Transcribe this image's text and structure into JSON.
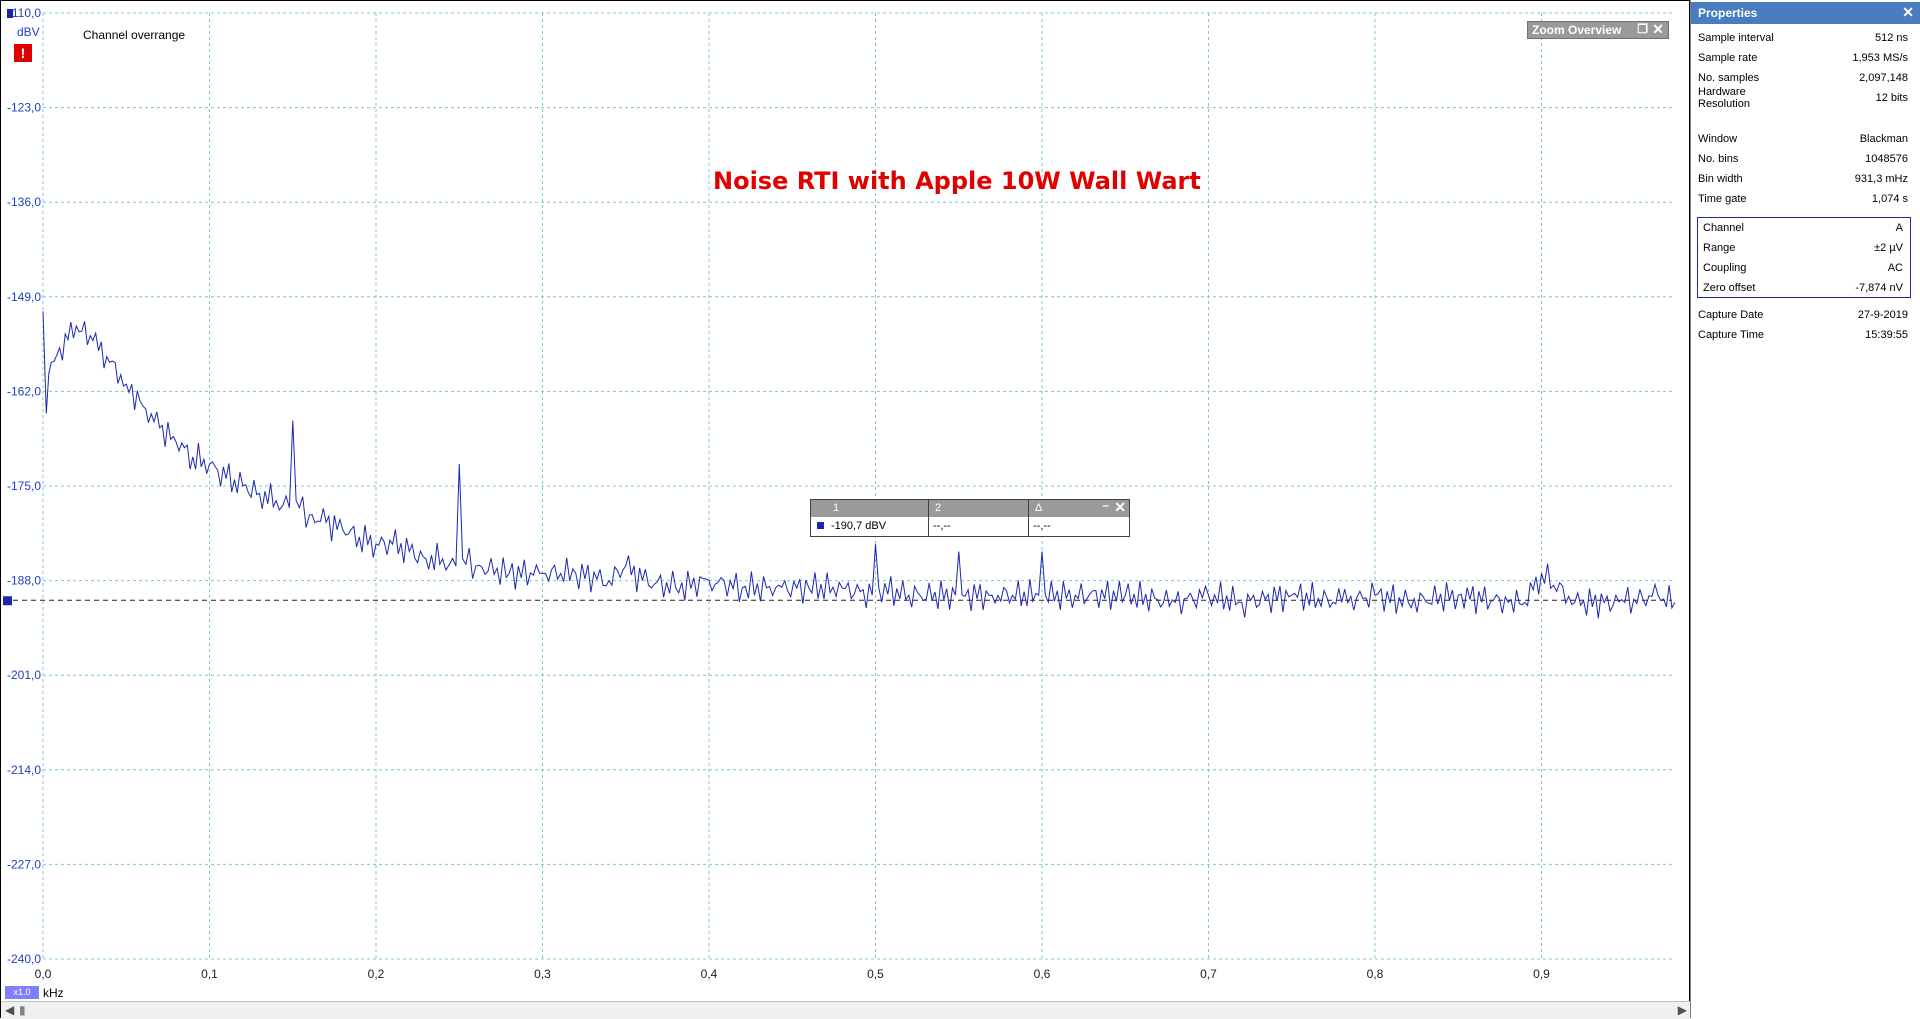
{
  "overrange_label": "Channel overrange",
  "unit_y": "dBV",
  "unit_x": "kHz",
  "zoom_badge": "x1.0",
  "zoom_overview": {
    "title": "Zoom Overview"
  },
  "ruler": {
    "headers": [
      "1",
      "2",
      "Δ"
    ],
    "values": [
      "-190,7 dBV",
      "--,--",
      "--,--"
    ]
  },
  "properties": {
    "title": "Properties",
    "rows": [
      {
        "k": "Sample interval",
        "v": "512 ns"
      },
      {
        "k": "Sample rate",
        "v": "1,953 MS/s"
      },
      {
        "k": "No. samples",
        "v": "2,097,148"
      },
      {
        "k": "Hardware Resolution",
        "v": "12 bits"
      },
      {
        "k": "Window",
        "v": "Blackman"
      },
      {
        "k": "No. bins",
        "v": "1048576"
      },
      {
        "k": "Bin width",
        "v": "931,3 mHz"
      },
      {
        "k": "Time gate",
        "v": "1,074 s"
      },
      {
        "k": "Channel",
        "v": "A"
      },
      {
        "k": "Range",
        "v": "±2 µV"
      },
      {
        "k": "Coupling",
        "v": "AC"
      },
      {
        "k": "Zero offset",
        "v": "-7,874 nV"
      },
      {
        "k": "Capture Date",
        "v": "27-9-2019"
      },
      {
        "k": "Capture Time",
        "v": "15:39:55"
      }
    ]
  },
  "chart_data": {
    "type": "line",
    "title": "Noise RTI with Apple 10W Wall Wart",
    "ylabel": "dBV",
    "xlabel": "kHz",
    "ylim": [
      -240,
      -110
    ],
    "xlim": [
      0,
      0.98
    ],
    "y_ticks": [
      "-110,0",
      "-123,0",
      "-136,0",
      "-149,0",
      "-162,0",
      "-175,0",
      "-188,0",
      "-201,0",
      "-214,0",
      "-227,0",
      "-240,0"
    ],
    "y_tick_values": [
      -110,
      -123,
      -136,
      -149,
      -162,
      -175,
      -188,
      -201,
      -214,
      -227,
      -240
    ],
    "x_ticks": [
      "0,0",
      "0,1",
      "0,2",
      "0,3",
      "0,4",
      "0,5",
      "0,6",
      "0,7",
      "0,8",
      "0,9"
    ],
    "x_tick_values": [
      0,
      0.1,
      0.2,
      0.3,
      0.4,
      0.5,
      0.6,
      0.7,
      0.8,
      0.9
    ],
    "grid": true,
    "cursor_level": -190.7,
    "series": [
      {
        "color": "#1a28b0",
        "x": [
          0.0,
          0.002,
          0.005,
          0.01,
          0.02,
          0.03,
          0.04,
          0.05,
          0.06,
          0.07,
          0.08,
          0.09,
          0.1,
          0.11,
          0.12,
          0.13,
          0.14,
          0.148,
          0.15,
          0.152,
          0.16,
          0.17,
          0.18,
          0.19,
          0.2,
          0.21,
          0.22,
          0.23,
          0.24,
          0.248,
          0.25,
          0.252,
          0.26,
          0.28,
          0.3,
          0.32,
          0.34,
          0.35,
          0.36,
          0.38,
          0.4,
          0.42,
          0.44,
          0.46,
          0.48,
          0.498,
          0.5,
          0.502,
          0.52,
          0.548,
          0.55,
          0.552,
          0.57,
          0.598,
          0.6,
          0.602,
          0.62,
          0.65,
          0.68,
          0.7,
          0.72,
          0.75,
          0.78,
          0.8,
          0.82,
          0.85,
          0.88,
          0.89,
          0.9,
          0.92,
          0.95,
          0.97,
          0.98
        ],
        "y": [
          -151,
          -165,
          -158,
          -156,
          -153,
          -155,
          -158,
          -161,
          -164,
          -167,
          -169,
          -171,
          -172,
          -174,
          -175,
          -176,
          -177,
          -178,
          -166,
          -177,
          -179,
          -180,
          -181,
          -182,
          -183,
          -183,
          -184,
          -185,
          -185,
          -186,
          -172,
          -185,
          -186,
          -187,
          -187,
          -187,
          -188,
          -186,
          -188,
          -189,
          -188,
          -189,
          -189,
          -189,
          -189,
          -190,
          -183,
          -189,
          -190,
          -190,
          -184,
          -190,
          -190,
          -190,
          -184,
          -190,
          -190,
          -190,
          -191,
          -190,
          -191,
          -190,
          -191,
          -190,
          -191,
          -190,
          -191,
          -191,
          -187,
          -191,
          -191,
          -190,
          -191
        ]
      }
    ]
  }
}
